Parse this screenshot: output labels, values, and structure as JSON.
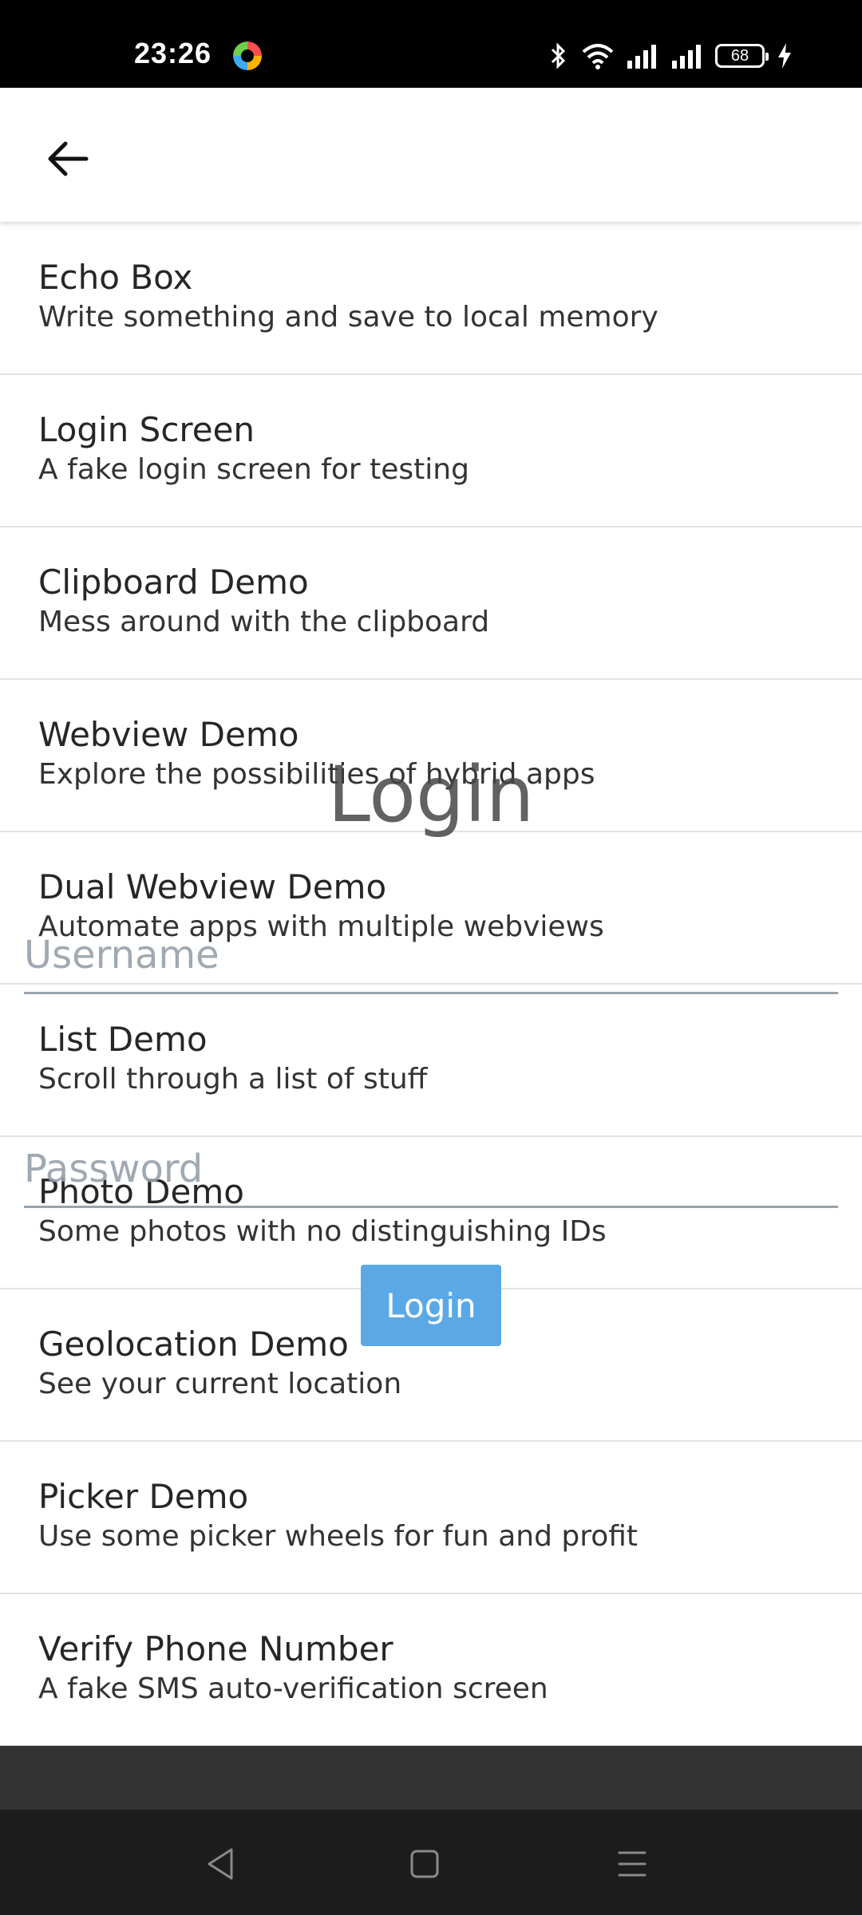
{
  "status_bar": {
    "time": "23:26",
    "battery": "68"
  },
  "app_bar": {
    "back_icon": "arrow-left-icon"
  },
  "list": [
    {
      "title": "Echo Box",
      "subtitle": "Write something and save to local memory"
    },
    {
      "title": "Login Screen",
      "subtitle": "A fake login screen for testing"
    },
    {
      "title": "Clipboard Demo",
      "subtitle": "Mess around with the clipboard"
    },
    {
      "title": "Webview Demo",
      "subtitle": "Explore the possibilities of hybrid apps"
    },
    {
      "title": "Dual Webview Demo",
      "subtitle": "Automate apps with multiple webviews"
    },
    {
      "title": "List Demo",
      "subtitle": "Scroll through a list of stuff"
    },
    {
      "title": "Photo Demo",
      "subtitle": "Some photos with no distinguishing IDs"
    },
    {
      "title": "Geolocation Demo",
      "subtitle": "See your current location"
    },
    {
      "title": "Picker Demo",
      "subtitle": "Use some picker wheels for fun and profit"
    },
    {
      "title": "Verify Phone Number",
      "subtitle": "A fake SMS auto-verification screen"
    }
  ],
  "login": {
    "title": "Login",
    "username_placeholder": "Username",
    "password_placeholder": "Password",
    "button_label": "Login"
  },
  "colors": {
    "status_bar": "#000000",
    "login_button": "#5aa9e6",
    "divider": "#e3e3e3",
    "nav_bar": "#1c1c1c"
  }
}
